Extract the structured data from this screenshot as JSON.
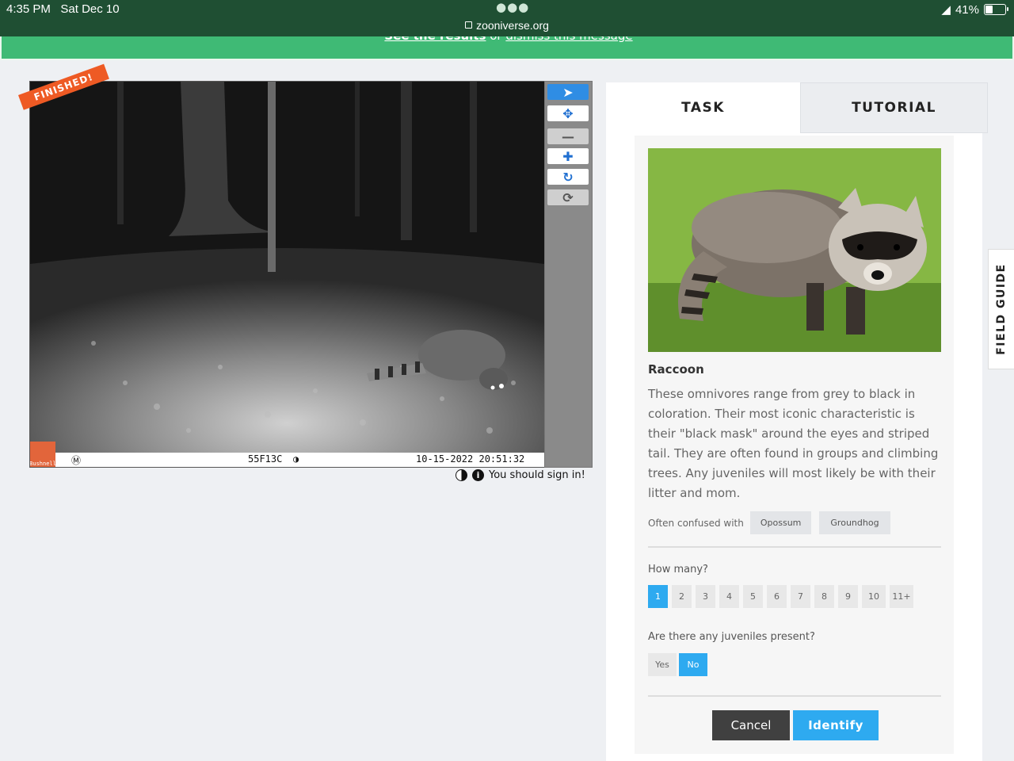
{
  "status_bar": {
    "time": "4:35 PM",
    "date": "Sat Dec 10",
    "url": "zooniverse.org",
    "battery": "41%"
  },
  "banner": {
    "link1": "See the results",
    "mid": "or",
    "link2": "dismiss this message"
  },
  "viewer": {
    "badge": "FINISHED!",
    "camera_brand": "Bushnell",
    "stamp_code": "55F13C",
    "stamp_datetime": "10-15-2022 20:51:32",
    "tools": [
      "pointer-icon",
      "move-icon",
      "zoom-out-icon",
      "zoom-in-icon",
      "rotate-icon",
      "reset-icon"
    ],
    "signin_text": "You should sign in!"
  },
  "panel": {
    "tab_task": "TASK",
    "tab_tutorial": "TUTORIAL",
    "species_name": "Raccoon",
    "description": "These omnivores range from grey to black in coloration. Their most iconic characteristic is their \"black mask\" around the eyes and striped tail. They are often found in groups and climbing trees. Any juveniles will most likely be with their litter and mom.",
    "confused_label": "Often confused with",
    "confused_with": [
      "Opossum",
      "Groundhog"
    ],
    "how_many_label": "How many?",
    "how_many_options": [
      "1",
      "2",
      "3",
      "4",
      "5",
      "6",
      "7",
      "8",
      "9",
      "10",
      "11+"
    ],
    "how_many_selected": "1",
    "juveniles_label": "Are there any juveniles present?",
    "juveniles_options": [
      "Yes",
      "No"
    ],
    "juveniles_selected": "No",
    "cancel_label": "Cancel",
    "identify_label": "Identify"
  },
  "field_guide_label": "FIELD GUIDE",
  "colors": {
    "status_bar": "#1f4f33",
    "banner": "#3fba75",
    "accent_blue": "#2eaaf0",
    "finished_badge": "#ee5a24"
  }
}
